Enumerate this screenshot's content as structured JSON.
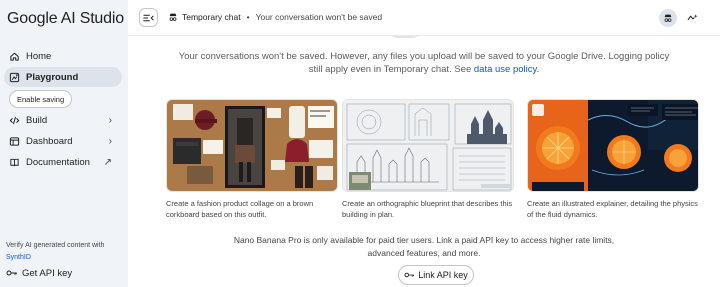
{
  "app": {
    "title": "Google AI Studio"
  },
  "sidebar": {
    "items": [
      {
        "label": "Home",
        "icon": "home-icon"
      },
      {
        "label": "Playground",
        "icon": "playground-icon",
        "active": true
      },
      {
        "label": "Build",
        "icon": "build-icon",
        "chevron": "›"
      },
      {
        "label": "Dashboard",
        "icon": "dashboard-icon",
        "chevron": "›"
      },
      {
        "label": "Documentation",
        "icon": "documentation-icon",
        "chevron": "↗"
      }
    ],
    "enable_saving": "Enable saving",
    "verify_text": "Verify AI generated content with",
    "verify_link": "SynthID",
    "api_key_label": "Get API key"
  },
  "header": {
    "chat_label": "Temporary chat",
    "separator": "•",
    "chat_subtitle": "Your conversation won't be saved",
    "accent": "#0b57d0"
  },
  "notice": {
    "text": "Your conversations won't be saved. However, any files you upload will be saved to your Google Drive. Logging policy still apply even in Temporary chat. See",
    "link": "data use policy",
    "end": "."
  },
  "cards": [
    {
      "caption": "Create a fashion product collage on a brown corkboard based on this outfit."
    },
    {
      "caption": "Create an orthographic blueprint that describes this building in plan."
    },
    {
      "caption": "Create an illustrated explainer, detailing the physics of the fluid dynamics."
    }
  ],
  "paid_notice": "Nano Banana Pro is only available for paid tier users. Link a paid API key to access higher rate limits, advanced features, and more.",
  "link_api_key": "Link API key"
}
